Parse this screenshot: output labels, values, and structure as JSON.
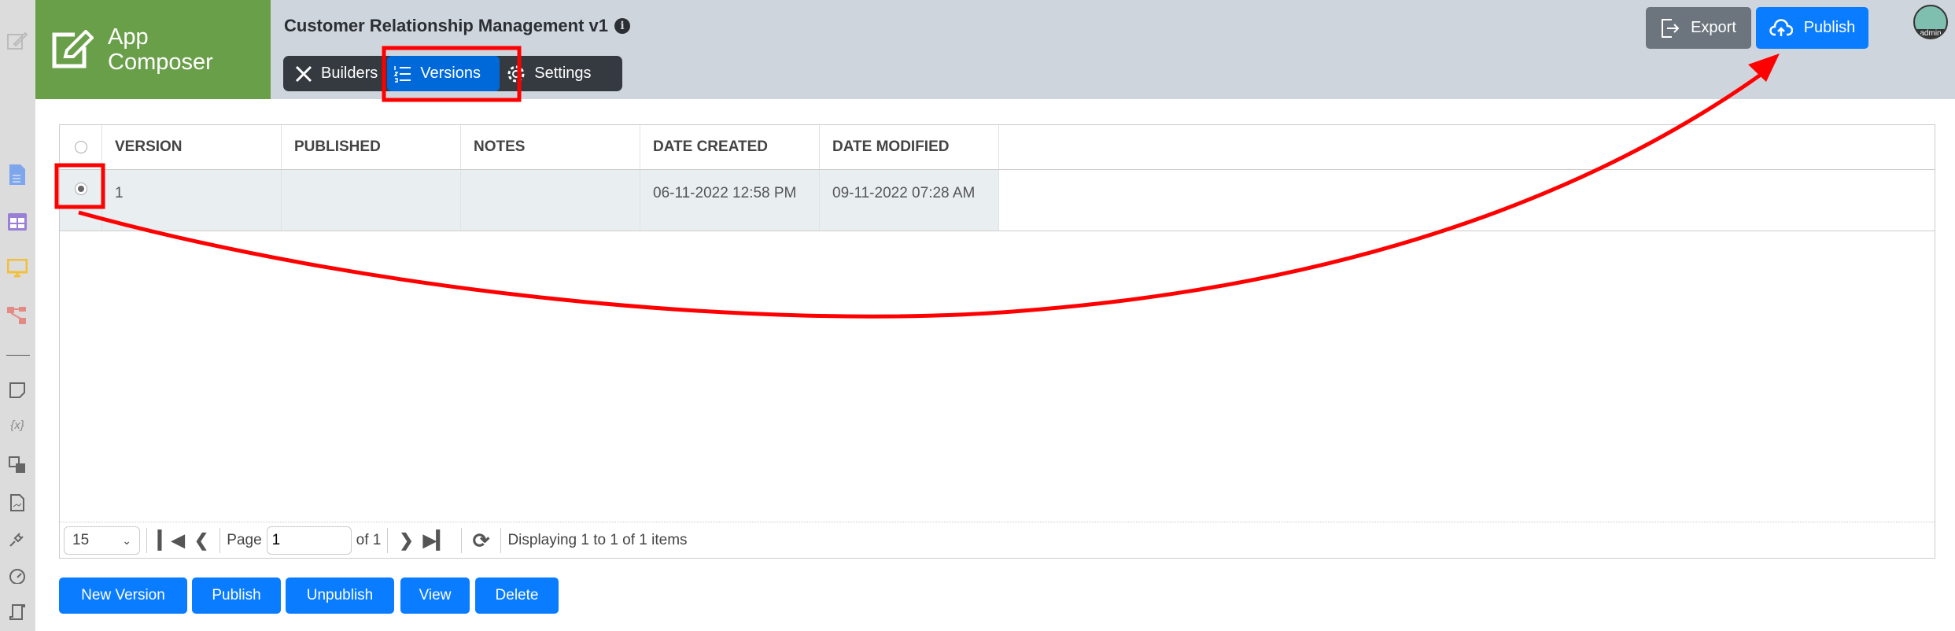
{
  "app": {
    "logo_line1": "App",
    "logo_line2": "Composer",
    "title": "Customer Relationship Management v1",
    "info_icon": "i"
  },
  "tabs": [
    {
      "label": "Builders",
      "icon": "builders-icon"
    },
    {
      "label": "Versions",
      "icon": "list-ol-icon",
      "active": true
    },
    {
      "label": "Settings",
      "icon": "gear-icon"
    }
  ],
  "toolbar": {
    "export_label": "Export",
    "publish_label": "Publish",
    "avatar_label": "admin"
  },
  "grid": {
    "columns": [
      "VERSION",
      "PUBLISHED",
      "NOTES",
      "DATE CREATED",
      "DATE MODIFIED"
    ],
    "rows": [
      {
        "selected": true,
        "version": "1",
        "published": "",
        "notes": "",
        "date_created": "06-11-2022 12:58 PM",
        "date_modified": "09-11-2022 07:28 AM"
      }
    ]
  },
  "pager": {
    "page_size": "15",
    "page_label": "Page",
    "page_value": "1",
    "of_label": "of 1",
    "status": "Displaying 1 to 1 of 1 items"
  },
  "actions": {
    "new_version": "New Version",
    "publish": "Publish",
    "unpublish": "Unpublish",
    "view": "View",
    "delete": "Delete"
  },
  "colors": {
    "accent": "#0a7cff",
    "logo_bg": "#6a9f4a",
    "header_bg": "#cfd5dc",
    "annotation": "#ff0000"
  }
}
